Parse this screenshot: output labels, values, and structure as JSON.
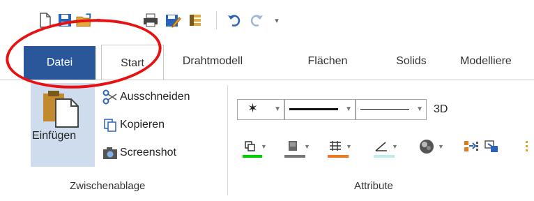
{
  "quick_access": {
    "icons": [
      "new-document-icon",
      "save-icon",
      "open-folder-icon",
      "print-icon",
      "save-as-icon",
      "properties-icon",
      "undo-icon",
      "redo-icon",
      "customize-qat-icon"
    ]
  },
  "tabs": {
    "file": "Datei",
    "items": [
      "Start",
      "Drahtmodell",
      "Flächen",
      "Solids",
      "Modelliere"
    ]
  },
  "clipboard": {
    "paste": "Einfügen",
    "cut": "Ausschneiden",
    "copy": "Kopieren",
    "screenshot": "Screenshot",
    "group": "Zwischenablage"
  },
  "attributes": {
    "view_mode": "3D",
    "group": "Attribute",
    "swatch_colors": [
      "#00d000",
      "#777777",
      "#f07820",
      "#c0eef0"
    ]
  },
  "annotation_color": "#e81010",
  "accent": "#2a579a"
}
